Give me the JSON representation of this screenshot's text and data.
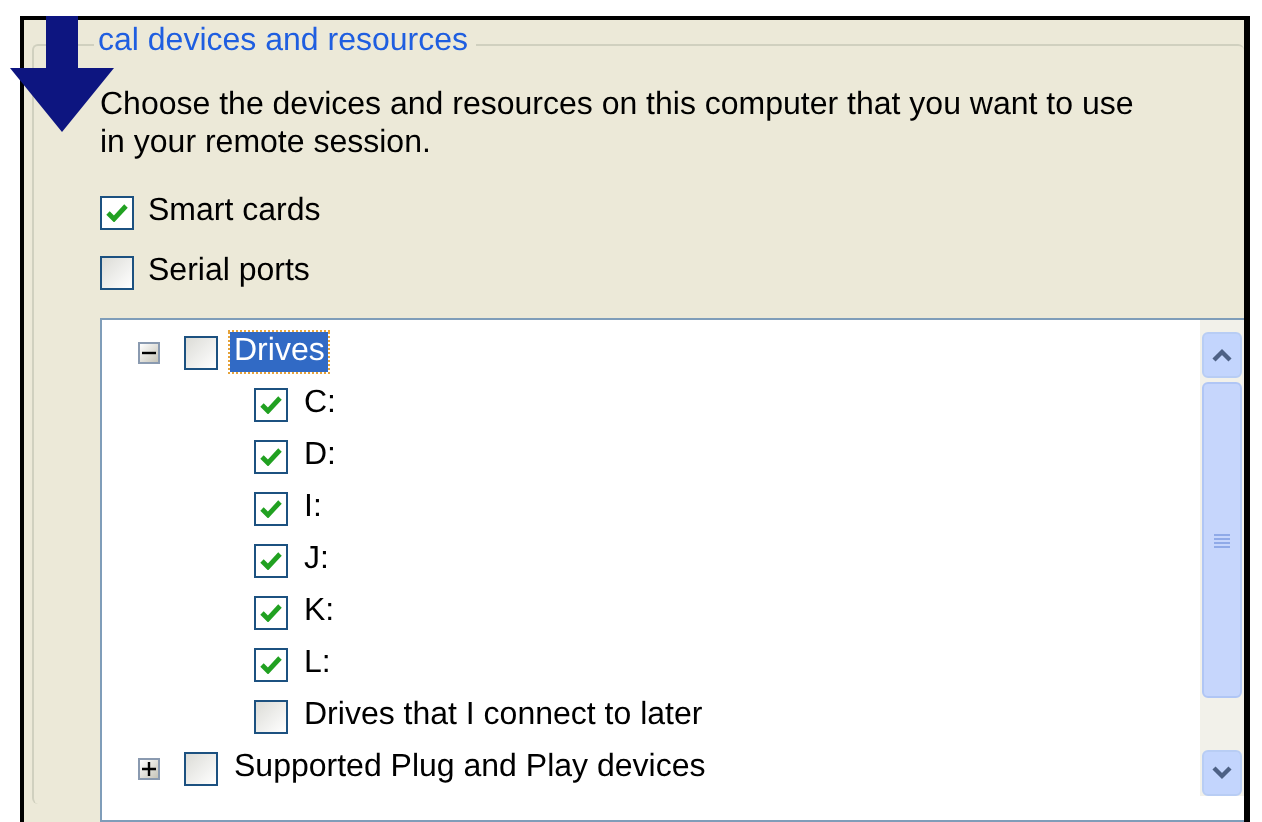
{
  "group": {
    "title": "cal devices and resources"
  },
  "description": "Choose the devices and resources on this computer that you want to use in your remote session.",
  "options": [
    {
      "label": "Smart cards",
      "checked": true
    },
    {
      "label": "Serial ports",
      "checked": false
    }
  ],
  "tree": {
    "items": [
      {
        "label": "Drives",
        "checked": false,
        "expanded": true,
        "selected": true,
        "children": [
          {
            "label": "C:",
            "checked": true,
            "selected": false
          },
          {
            "label": "D:",
            "checked": true,
            "selected": false
          },
          {
            "label": "I:",
            "checked": true,
            "selected": false
          },
          {
            "label": "J:",
            "checked": true,
            "selected": false
          },
          {
            "label": "K:",
            "checked": true,
            "selected": false
          },
          {
            "label": "L:",
            "checked": true,
            "selected": false
          },
          {
            "label": "Drives that I connect to later",
            "checked": false,
            "selected": false
          }
        ]
      },
      {
        "label": "Supported Plug and Play devices",
        "checked": false,
        "expanded": false,
        "selected": false
      }
    ]
  }
}
